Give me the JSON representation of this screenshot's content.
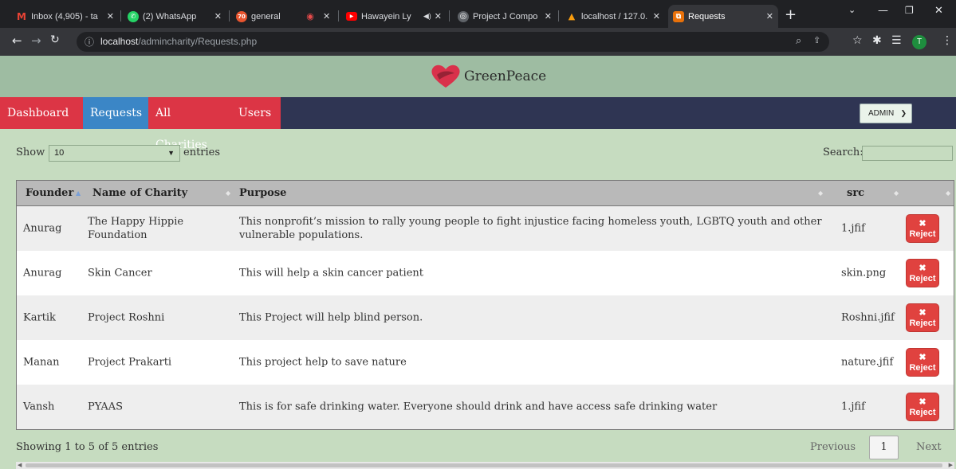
{
  "browser": {
    "tabs": [
      {
        "title": "Inbox (4,905) - ta",
        "icon": "gmail-icon",
        "color": "#ea4335",
        "glyph": "M"
      },
      {
        "title": "(2) WhatsApp",
        "icon": "whatsapp-icon",
        "color": "#25d366",
        "glyph": "☎"
      },
      {
        "title": "general",
        "icon": "discord-icon",
        "color": "#e8552f",
        "glyph": "70"
      },
      {
        "title": "",
        "icon": "record-icon",
        "color": "#e84b4b",
        "glyph": "◉"
      },
      {
        "title": "Hawayein Ly",
        "icon": "youtube-icon",
        "color": "#ff0000",
        "glyph": "▶"
      },
      {
        "title": "Project J Compo",
        "icon": "globe-icon",
        "color": "#5f6368",
        "glyph": "◎"
      },
      {
        "title": "localhost / 127.0.",
        "icon": "phpmyadmin-icon",
        "color": "#f89c0e",
        "glyph": "▲"
      },
      {
        "title": "Requests",
        "icon": "codepen-icon",
        "color": "#e8710a",
        "glyph": "⧉"
      }
    ],
    "url_host": "localhost",
    "url_path": "/admincharity/Requests.php",
    "profile_initial": "T"
  },
  "site": {
    "brand": "GreenPeace",
    "nav": [
      {
        "label": "Dashboard"
      },
      {
        "label": "Requests"
      },
      {
        "label": "All Charities"
      },
      {
        "label": "Users"
      }
    ],
    "admin_select": "ADMIN"
  },
  "table_controls": {
    "show_label": "Show",
    "length_value": "10",
    "entries_label": "entries",
    "search_label": "Search:"
  },
  "table": {
    "columns": [
      "Founder",
      "Name of Charity",
      "Purpose",
      "src",
      ""
    ],
    "rows": [
      {
        "founder": "Anurag",
        "charity": "The Happy Hippie Foundation",
        "purpose": "This nonprofit’s mission to rally young people to fight injustice facing homeless youth, LGBTQ youth and other vulnerable populations.",
        "src": "1.jfif",
        "action": "Reject"
      },
      {
        "founder": "Anurag",
        "charity": "Skin Cancer",
        "purpose": "This will help a skin cancer patient",
        "src": "skin.png",
        "action": "Reject"
      },
      {
        "founder": "Kartik",
        "charity": "Project Roshni",
        "purpose": "This Project will help blind person.",
        "src": "Roshni.jfif",
        "action": "Reject"
      },
      {
        "founder": "Manan",
        "charity": "Project Prakarti",
        "purpose": "This project help to save nature",
        "src": "nature.jfif",
        "action": "Reject"
      },
      {
        "founder": "Vansh",
        "charity": "PYAAS",
        "purpose": "This is for safe drinking water. Everyone should drink and have access safe drinking water",
        "src": "1.jfif",
        "action": "Reject"
      }
    ]
  },
  "footer": {
    "info": "Showing 1 to 5 of 5 entries",
    "previous": "Previous",
    "page": "1",
    "next": "Next"
  }
}
